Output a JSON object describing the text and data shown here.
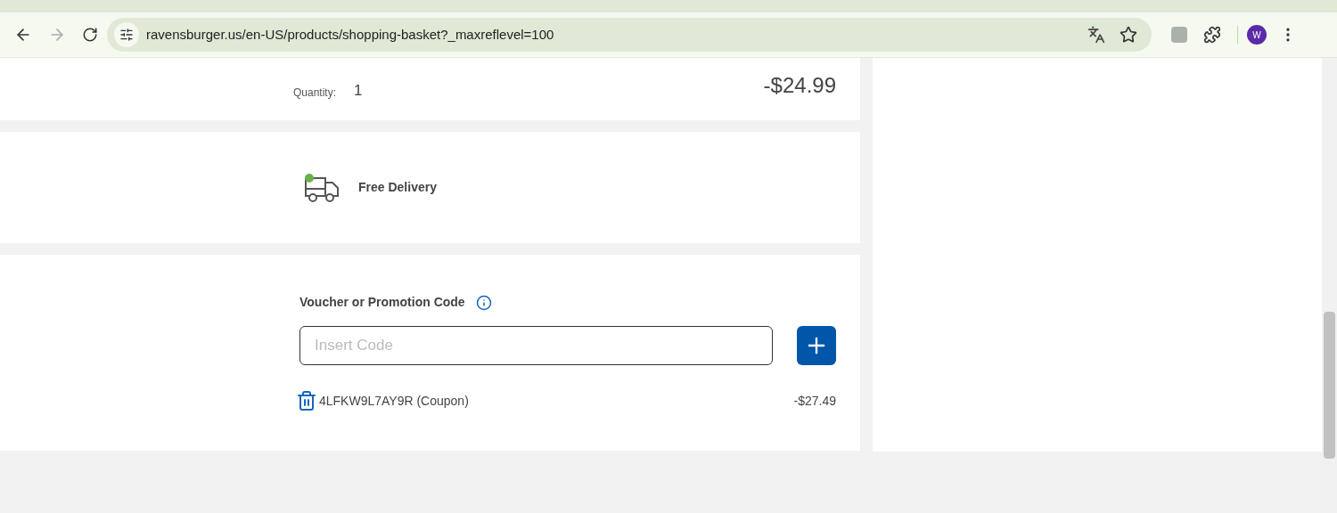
{
  "browser": {
    "url": "ravensburger.us/en-US/products/shopping-basket?_maxreflevel=100",
    "profile_initial": "W"
  },
  "item": {
    "quantity_label": "Quantity:",
    "quantity": "1",
    "price": "-$24.99"
  },
  "delivery": {
    "label": "Free Delivery"
  },
  "voucher": {
    "title": "Voucher or Promotion Code",
    "placeholder": "Insert Code",
    "coupons": [
      {
        "code": "4LFKW9L7AY9R (Coupon)",
        "amount": "-$27.49"
      }
    ]
  }
}
